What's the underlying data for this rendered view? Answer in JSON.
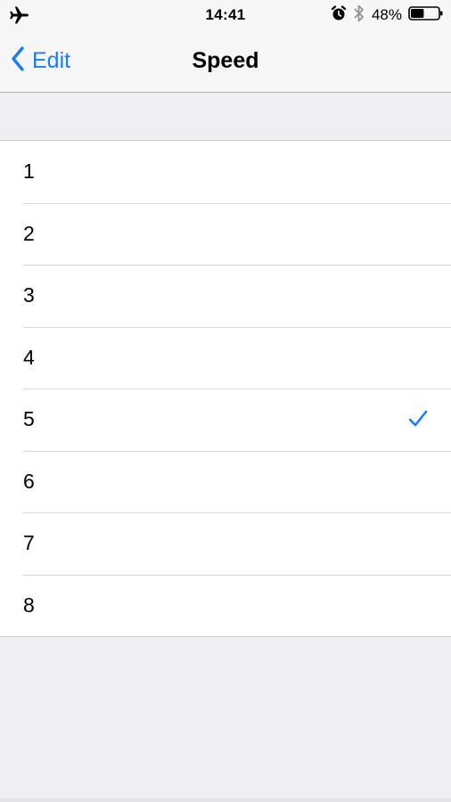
{
  "status_bar": {
    "time": "14:41",
    "battery_percent": "48%",
    "battery_level": 0.48,
    "icons": [
      "airplane-mode-icon",
      "alarm-icon",
      "bluetooth-icon",
      "battery-icon"
    ]
  },
  "nav": {
    "back_label": "Edit",
    "title": "Speed"
  },
  "options": [
    {
      "label": "1",
      "selected": false
    },
    {
      "label": "2",
      "selected": false
    },
    {
      "label": "3",
      "selected": false
    },
    {
      "label": "4",
      "selected": false
    },
    {
      "label": "5",
      "selected": true
    },
    {
      "label": "6",
      "selected": false
    },
    {
      "label": "7",
      "selected": false
    },
    {
      "label": "8",
      "selected": false
    }
  ],
  "colors": {
    "accent": "#1a7cf5",
    "background": "#efeff4"
  }
}
